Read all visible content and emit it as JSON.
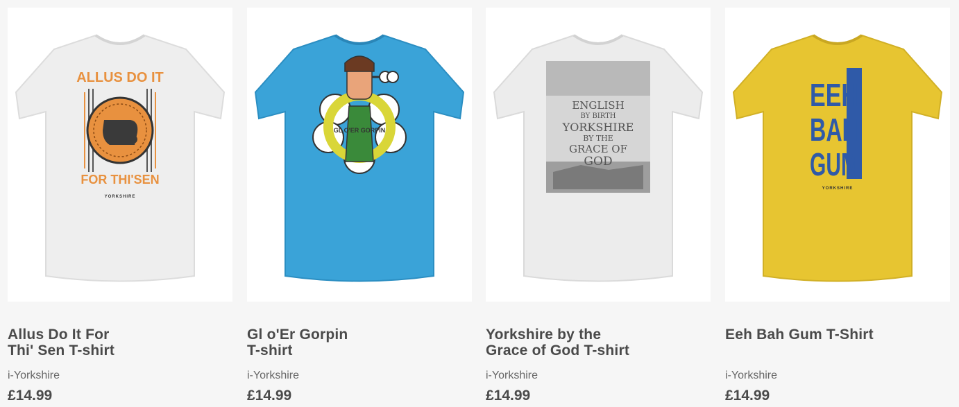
{
  "products": [
    {
      "title": "Allus Do It For\nThi' Sen T-shirt",
      "vendor": "i-Yorkshire",
      "price": "£14.99",
      "shirt_color": "#eeeeee",
      "design": {
        "top": "ALLUS DO IT",
        "bottom": "FOR THI'SEN",
        "small": "YORKSHIRE"
      },
      "accent": "#e8913f"
    },
    {
      "title": "Gl o'Er Gorpin\nT-shirt",
      "vendor": "i-Yorkshire",
      "price": "£14.99",
      "shirt_color": "#3aa3d8",
      "design": {
        "ring": "GL O'ER GORPIN"
      },
      "accent": "#d9d638"
    },
    {
      "title": "Yorkshire by the\nGrace of God T-shirt",
      "vendor": "i-Yorkshire",
      "price": "£14.99",
      "shirt_color": "#ececec",
      "design": {
        "line1": "ENGLISH",
        "line2": "BY BIRTH",
        "line3": "YORKSHIRE",
        "line4": "BY THE",
        "line5": "GRACE OF",
        "line6": "GOD"
      },
      "accent": "#6f6f6f"
    },
    {
      "title": "Eeh Bah Gum T-Shirt",
      "vendor": "i-Yorkshire",
      "price": "£14.99",
      "shirt_color": "#e7c531",
      "design": {
        "line1": "EEH",
        "line2": "BAH",
        "line3": "GUM",
        "small": "YORKSHIRE"
      },
      "accent": "#2f5aa8"
    }
  ]
}
